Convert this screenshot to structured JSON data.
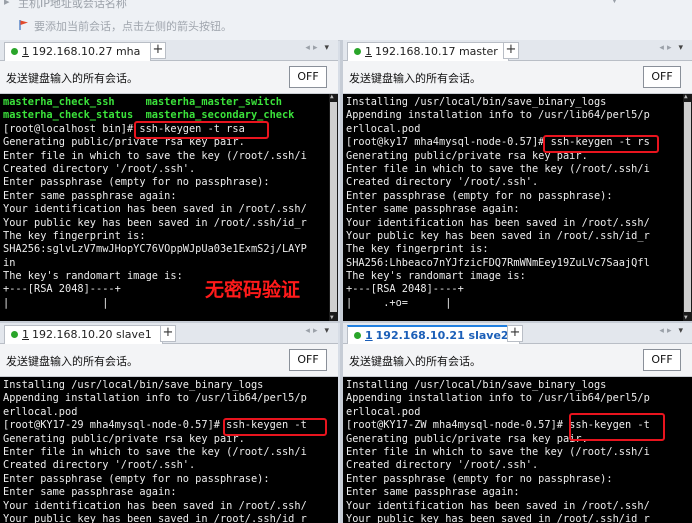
{
  "topbar": {
    "host_placeholder": "主机IP地址或会话名称",
    "hint": "要添加当前会话，点击左侧的箭头按钮。"
  },
  "send_all_label": "发送键盘输入的所有会话。",
  "off_label": "OFF",
  "red_annotation": "无密码验证",
  "panes": [
    {
      "tab_num": "1",
      "tab_label": "192.168.10.27 mha",
      "lines": [
        {
          "t": "masterha_check_ssh     masterha_master_switch",
          "c": "green"
        },
        {
          "t": "masterha_check_status  masterha_secondary_check",
          "c": "green"
        },
        {
          "t": "[root@localhost bin]# ssh-keygen -t rsa",
          "c": ""
        },
        {
          "t": "Generating public/private rsa key pair.",
          "c": ""
        },
        {
          "t": "Enter file in which to save the key (/root/.ssh/i",
          "c": ""
        },
        {
          "t": "Created directory '/root/.ssh'.",
          "c": ""
        },
        {
          "t": "Enter passphrase (empty for no passphrase):",
          "c": ""
        },
        {
          "t": "Enter same passphrase again:",
          "c": ""
        },
        {
          "t": "Your identification has been saved in /root/.ssh/",
          "c": ""
        },
        {
          "t": "Your public key has been saved in /root/.ssh/id_r",
          "c": ""
        },
        {
          "t": "The key fingerprint is:",
          "c": ""
        },
        {
          "t": "SHA256:sglvLzV7mwJHopYC76VOppWJpUa03e1ExmS2j/LAYP",
          "c": ""
        },
        {
          "t": "in",
          "c": ""
        },
        {
          "t": "The key's randomart image is:",
          "c": ""
        },
        {
          "t": "+---[RSA 2048]----+",
          "c": ""
        },
        {
          "t": "|               |",
          "c": ""
        }
      ]
    },
    {
      "tab_num": "1",
      "tab_label": "192.168.10.17 master",
      "lines": [
        {
          "t": "Installing /usr/local/bin/save_binary_logs",
          "c": ""
        },
        {
          "t": "Appending installation info to /usr/lib64/perl5/p",
          "c": ""
        },
        {
          "t": "erllocal.pod",
          "c": ""
        },
        {
          "t": "[root@ky17 mha4mysql-node-0.57]# ssh-keygen -t rs",
          "c": ""
        },
        {
          "t": "Generating public/private rsa key pair.",
          "c": ""
        },
        {
          "t": "Enter file in which to save the key (/root/.ssh/i",
          "c": ""
        },
        {
          "t": "Created directory '/root/.ssh'.",
          "c": ""
        },
        {
          "t": "Enter passphrase (empty for no passphrase):",
          "c": ""
        },
        {
          "t": "Enter same passphrase again:",
          "c": ""
        },
        {
          "t": "Your identification has been saved in /root/.ssh/",
          "c": ""
        },
        {
          "t": "Your public key has been saved in /root/.ssh/id_r",
          "c": ""
        },
        {
          "t": "The key fingerprint is:",
          "c": ""
        },
        {
          "t": "SHA256:Lhbeaco7nYJfzicFDQ7RmWNmEey19ZuLVc7SaajQfl",
          "c": ""
        },
        {
          "t": "The key's randomart image is:",
          "c": ""
        },
        {
          "t": "+---[RSA 2048]----+",
          "c": ""
        },
        {
          "t": "|     .+o=      |",
          "c": ""
        }
      ]
    },
    {
      "tab_num": "1",
      "tab_label": "192.168.10.20 slave1",
      "lines": [
        {
          "t": "Installing /usr/local/bin/save_binary_logs",
          "c": ""
        },
        {
          "t": "Appending installation info to /usr/lib64/perl5/p",
          "c": ""
        },
        {
          "t": "erllocal.pod",
          "c": ""
        },
        {
          "t": "[root@KY17-29 mha4mysql-node-0.57]# ssh-keygen -t",
          "c": ""
        },
        {
          "t": "Generating public/private rsa key pair.",
          "c": ""
        },
        {
          "t": "Enter file in which to save the key (/root/.ssh/i",
          "c": ""
        },
        {
          "t": "Created directory '/root/.ssh'.",
          "c": ""
        },
        {
          "t": "Enter passphrase (empty for no passphrase):",
          "c": ""
        },
        {
          "t": "Enter same passphrase again:",
          "c": ""
        },
        {
          "t": "Your identification has been saved in /root/.ssh/",
          "c": ""
        },
        {
          "t": "Your public key has been saved in /root/.ssh/id_r",
          "c": ""
        }
      ]
    },
    {
      "tab_num": "1",
      "tab_label": "192.168.10.21 slave2",
      "lines": [
        {
          "t": "Installing /usr/local/bin/save_binary_logs",
          "c": ""
        },
        {
          "t": "Appending installation info to /usr/lib64/perl5/p",
          "c": ""
        },
        {
          "t": "erllocal.pod",
          "c": ""
        },
        {
          "t": "[root@KY17-ZW mha4mysql-node-0.57]# ssh-keygen -t",
          "c": ""
        },
        {
          "t": "Generating public/private rsa key pair.",
          "c": ""
        },
        {
          "t": "Enter file in which to save the key (/root/.ssh/i",
          "c": ""
        },
        {
          "t": "Created directory '/root/.ssh'.",
          "c": ""
        },
        {
          "t": "Enter passphrase (empty for no passphrase):",
          "c": ""
        },
        {
          "t": "Enter same passphrase again:",
          "c": ""
        },
        {
          "t": "Your identification has been saved in /root/.ssh/",
          "c": ""
        },
        {
          "t": "Your public key has been saved in /root/.ssh/id_r",
          "c": ""
        }
      ]
    }
  ]
}
